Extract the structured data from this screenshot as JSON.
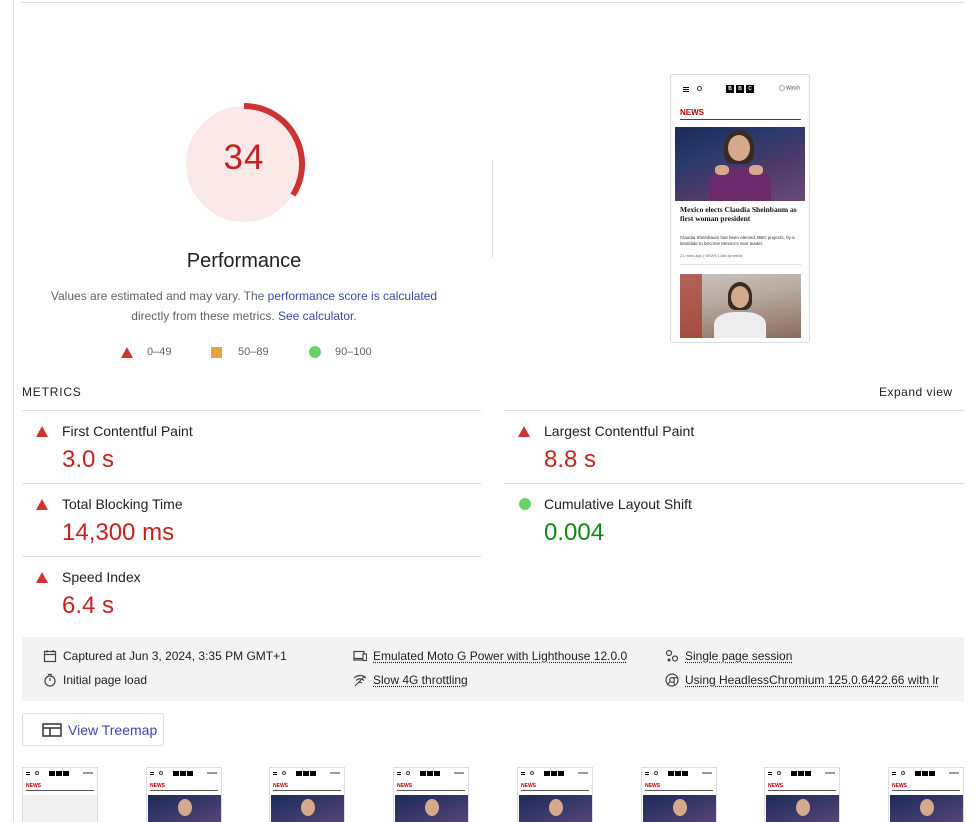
{
  "gauge": {
    "score": "34",
    "score_fraction": 0.34,
    "title": "Performance",
    "color": "#cc3333",
    "track_color": "#fbe9e9"
  },
  "disclaimer": {
    "prefix": "Values are estimated and may vary. The ",
    "link1": "performance score is calculated",
    "middle": " directly from these metrics. ",
    "link2": "See calculator",
    "suffix": "."
  },
  "legend": {
    "fail": "0–49",
    "average": "50–89",
    "pass": "90–100"
  },
  "screenshot": {
    "watch": "Watch",
    "section": "NEWS",
    "headline": "Mexico elects Claudia Sheinbaum as first woman president",
    "summary": "Claudia Sheinbaum has been elected, BBC projects, by a landslide to become Mexico's next leader.",
    "meta": "21 mins ago | NEWS  Latin America"
  },
  "metrics": {
    "header": "METRICS",
    "expand": "Expand view",
    "items": [
      {
        "label": "First Contentful Paint",
        "value": "3.0 s",
        "rating": "fail"
      },
      {
        "label": "Largest Contentful Paint",
        "value": "8.8 s",
        "rating": "fail"
      },
      {
        "label": "Total Blocking Time",
        "value": "14,300 ms",
        "rating": "fail"
      },
      {
        "label": "Cumulative Layout Shift",
        "value": "0.004",
        "rating": "pass"
      },
      {
        "label": "Speed Index",
        "value": "6.4 s",
        "rating": "fail"
      }
    ]
  },
  "runinfo": {
    "captured": "Captured at Jun 3, 2024, 3:35 PM GMT+1",
    "load": "Initial page load",
    "device": "Emulated Moto G Power with Lighthouse 12.0.0",
    "throttling": "Slow 4G throttling",
    "session": "Single page session",
    "browser": "Using HeadlessChromium 125.0.6422.66 with lr"
  },
  "treemap": {
    "label": "View Treemap"
  },
  "filmstrip": {
    "section_label": "NEWS",
    "frames": 8
  }
}
